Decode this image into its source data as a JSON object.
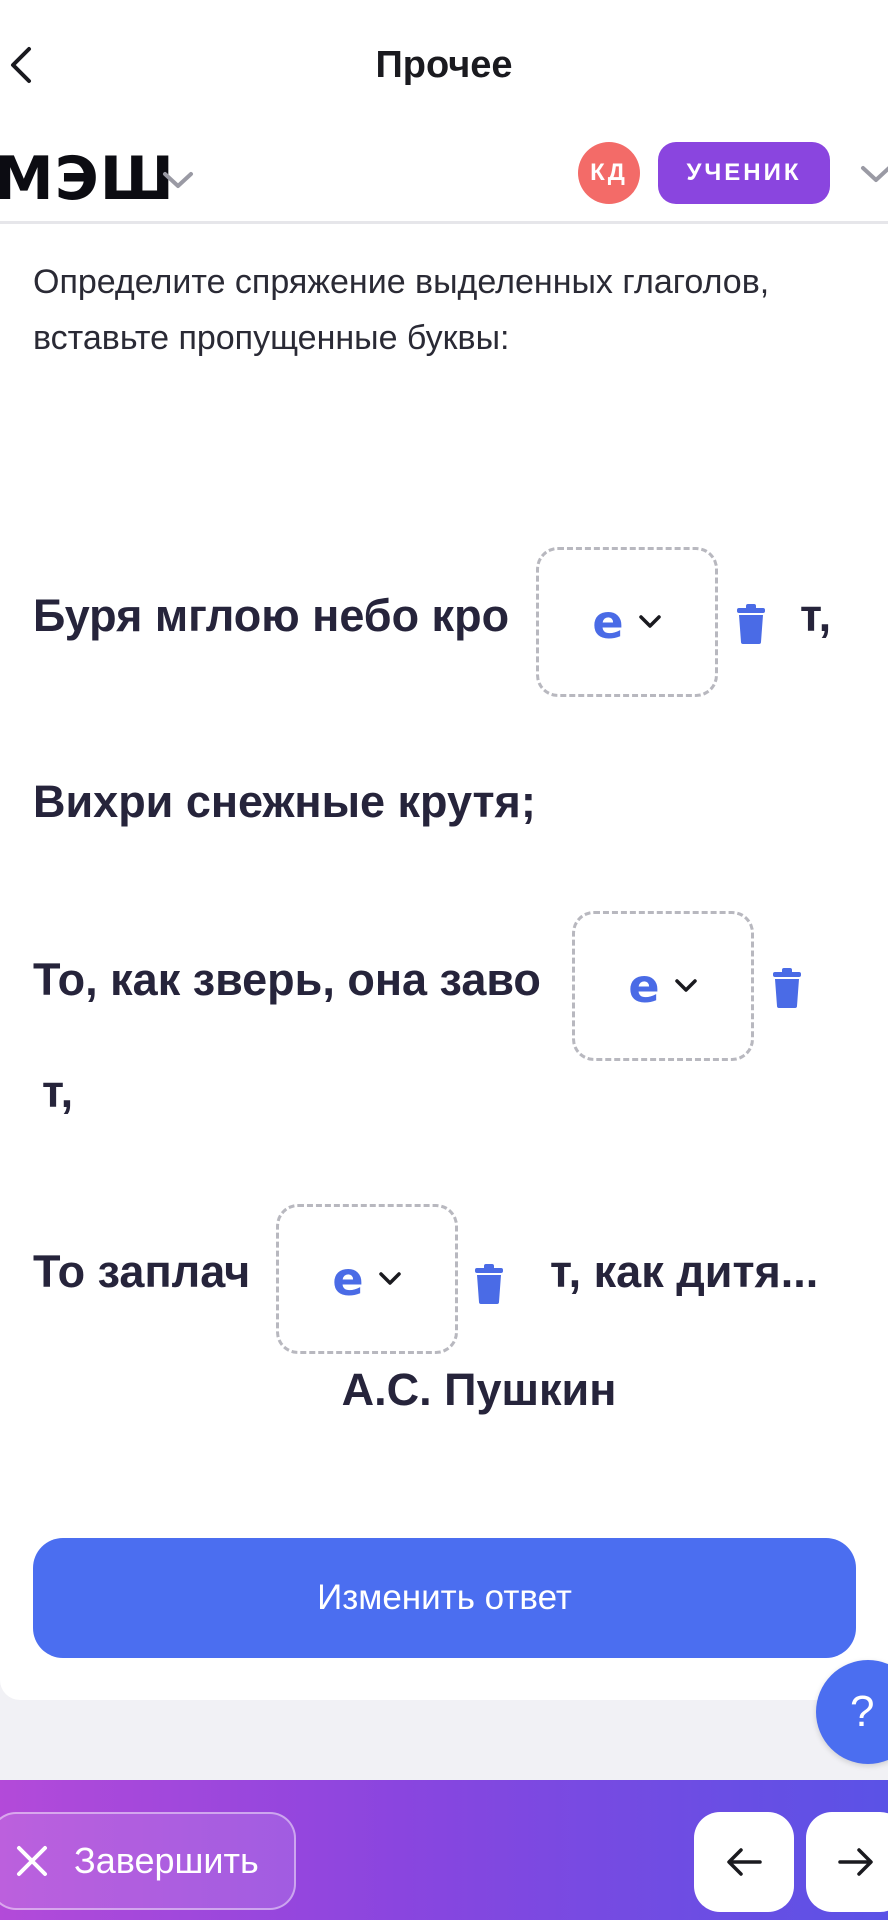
{
  "nav": {
    "title": "Прочее",
    "back_icon": "chevron-left-icon"
  },
  "header": {
    "brand": "МЭШ",
    "avatar_initials": "КД",
    "role": "УЧЕНИК",
    "colors": {
      "avatar": "#f36b68",
      "role_badge": "#8a45df"
    }
  },
  "task": {
    "instructions": "Определите спряжение выделенных глаголов, вставьте пропущенные буквы:",
    "lines": [
      {
        "before": "Буря мглою небо кро",
        "after": "т,"
      },
      {
        "text": "Вихри снежные крутя;"
      },
      {
        "before": "То, как зверь, она заво",
        "after": "т,"
      },
      {
        "before": "То заплач",
        "after": "т, как дитя..."
      }
    ],
    "answers": [
      "е",
      "е",
      "е"
    ],
    "author": "А.С. Пушкин"
  },
  "actions": {
    "change_answer": "Изменить ответ",
    "help": "?",
    "finish": "Завершить"
  },
  "colors": {
    "accent": "#4b6ef0",
    "answer_letter": "#4a6be6",
    "text_dark": "#26243b"
  }
}
